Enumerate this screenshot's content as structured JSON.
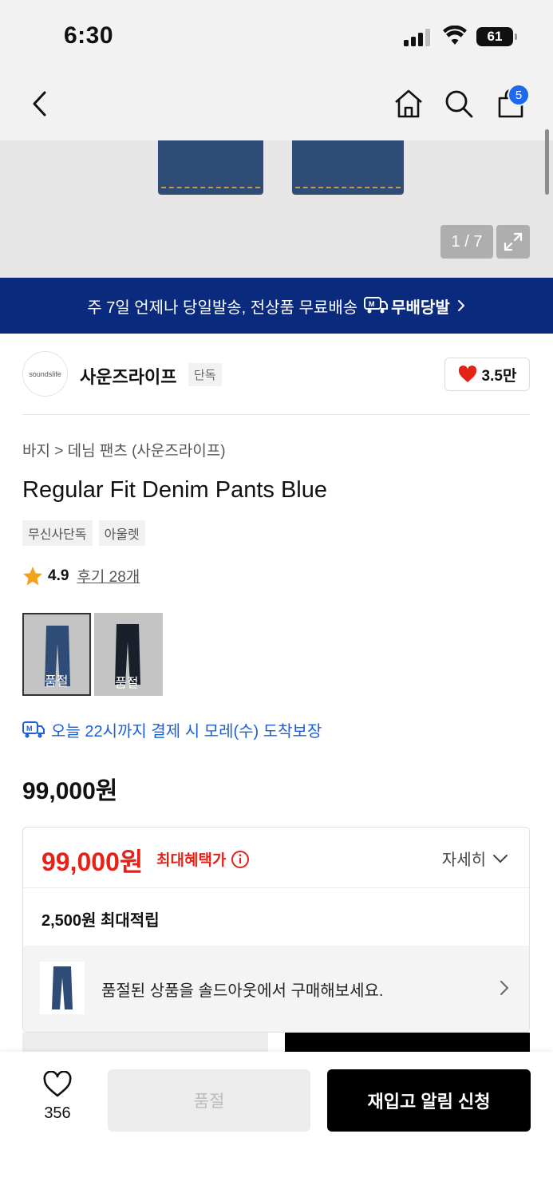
{
  "status_bar": {
    "time": "6:30",
    "battery": "61"
  },
  "nav": {
    "cart_count": "5",
    "icons": [
      "back-icon",
      "home-icon",
      "search-icon",
      "cart-icon"
    ]
  },
  "gallery": {
    "counter": "1 / 7"
  },
  "banner": {
    "text": "주 7일 언제나 당일발송, 전상품 무료배송",
    "service": "무배당발"
  },
  "brand": {
    "logo_text": "soundslife",
    "name": "사운즈라이프",
    "tag": "단독",
    "likes": "3.5만"
  },
  "breadcrumb": {
    "category": "바지",
    "sub": "데님 팬츠 (사운즈라이프)"
  },
  "product": {
    "title": "Regular Fit Denim Pants Blue",
    "tags": [
      "무신사단독",
      "아울렛"
    ],
    "rating": "4.9",
    "reviews": "후기 28개",
    "price": "99,000원"
  },
  "options": [
    {
      "label": "품절",
      "color": "#2f4c77"
    },
    {
      "label": "품절",
      "color": "#1a1f2c"
    }
  ],
  "delivery": {
    "text": "오늘 22시까지 결제 시 모레(수) 도착보장"
  },
  "benefit": {
    "max_price": "99,000원",
    "max_label": "최대혜택가",
    "detail": "자세히",
    "points": "2,500원 최대적립",
    "soldout_text": "품절된 상품을 솔드아웃에서 구매해보세요."
  },
  "bottom": {
    "like_count": "356",
    "soldout": "품절",
    "restock": "재입고 알림 신청"
  },
  "colors": {
    "accent_blue": "#1d6af0",
    "banner_navy": "#0a2a7e",
    "red": "#e52218"
  }
}
